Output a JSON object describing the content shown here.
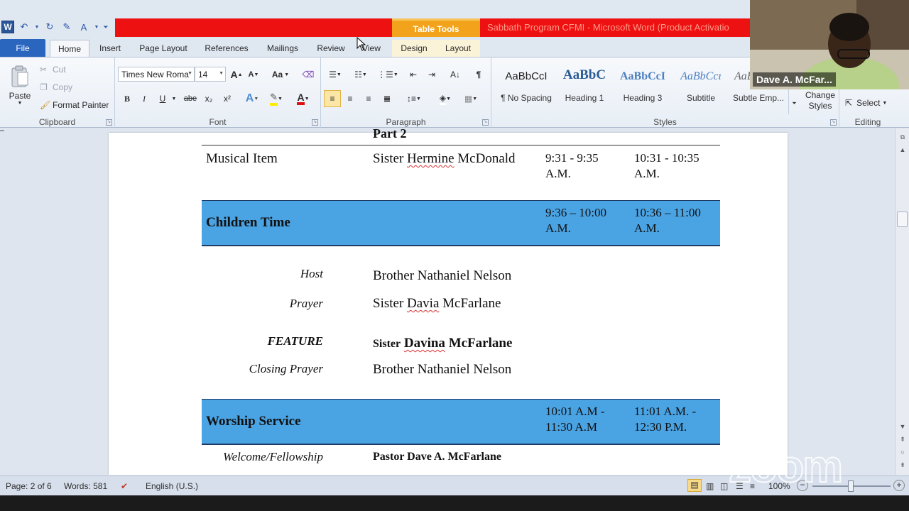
{
  "window": {
    "title": "Sabbath Program CFMI  -  Microsoft Word (Product Activatio",
    "context_tab_group": "Table Tools"
  },
  "tabs": {
    "file": "File",
    "home": "Home",
    "insert": "Insert",
    "page_layout": "Page Layout",
    "references": "References",
    "mailings": "Mailings",
    "review": "Review",
    "view": "View",
    "design": "Design",
    "layout": "Layout"
  },
  "ribbon": {
    "clipboard": {
      "label": "Clipboard",
      "paste": "Paste",
      "cut": "Cut",
      "copy": "Copy",
      "format_painter": "Format Painter"
    },
    "font": {
      "label": "Font",
      "font_name": "Times New Roma",
      "font_size": "14",
      "bold": "B",
      "italic": "I",
      "underline": "U",
      "strikethrough": "abe",
      "subscript": "x₂",
      "superscript": "x²",
      "grow": "A",
      "shrink": "A",
      "change_case": "Aa"
    },
    "paragraph": {
      "label": "Paragraph"
    },
    "styles": {
      "label": "Styles",
      "items": [
        {
          "sample": "AaBbCcI",
          "name": "¶ No Spacing"
        },
        {
          "sample": "AaBbC",
          "name": "Heading 1"
        },
        {
          "sample": "AaBbCcI",
          "name": "Heading 3"
        },
        {
          "sample": "AaBbCcı",
          "name": "Subtitle"
        },
        {
          "sample": "AaBbCcI",
          "name": "Subtle Emp..."
        }
      ],
      "change_styles": "Change Styles"
    },
    "editing": {
      "label": "Editing",
      "select": "Select"
    }
  },
  "document": {
    "part_heading_fragment": "Part 2",
    "rows": {
      "musical_item": {
        "item": "Musical Item",
        "person": "Sister Hermine McDonald",
        "time1": "9:31 - 9:35 A.M.",
        "time2": "10:31 - 10:35 A.M."
      },
      "children_time": {
        "title": "Children Time",
        "time1_a": "9:36 – 10:00",
        "time1_b": "A.M.",
        "time2_a": "10:36 – 11:00",
        "time2_b": "A.M."
      },
      "host": {
        "label": "Host",
        "person": "Brother Nathaniel Nelson"
      },
      "prayer": {
        "label": "Prayer",
        "person_first": "Sister",
        "person_squiggle": "Davia",
        "person_last": "McFarlane"
      },
      "feature": {
        "label": "FEATURE",
        "person_prefix": "Sister",
        "person_squiggle": "Davina",
        "person_last": "McFarlane"
      },
      "closing_prayer": {
        "label": "Closing Prayer",
        "person": "Brother Nathaniel Nelson"
      },
      "worship_service": {
        "title": "Worship Service",
        "time1_a": "10:01 A.M -",
        "time1_b": "11:30 A.M",
        "time2_a": "11:01 A.M. -",
        "time2_b": "12:30 P.M."
      },
      "welcome": {
        "label": "Welcome/Fellowship",
        "person": "Pastor Dave A. McFarlane"
      }
    }
  },
  "statusbar": {
    "page": "Page: 2 of 6",
    "words": "Words: 581",
    "language": "English (U.S.)",
    "zoom": "100%"
  },
  "video": {
    "participant_name": "Dave A. McFar..."
  },
  "overlay": {
    "watermark": "zoom"
  },
  "colors": {
    "band": "#4aa3e3",
    "title_red": "#ee1111",
    "table_tools": "#f2a31b",
    "file_tab": "#2a66be"
  }
}
